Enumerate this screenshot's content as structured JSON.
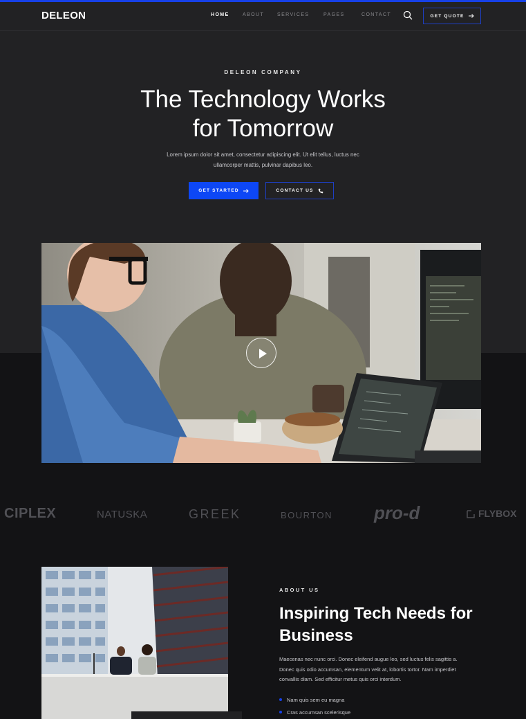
{
  "header": {
    "logo": "DELEON",
    "nav": [
      "HOME",
      "ABOUT",
      "SERVICES",
      "PAGES",
      "CONTACT"
    ],
    "active_nav": "HOME",
    "quote_button": "GET QUOTE"
  },
  "hero": {
    "eyebrow": "DELEON COMPANY",
    "title_lines": [
      "The Technology Works",
      "for Tomorrow"
    ],
    "description_lines": [
      "Lorem ipsum dolor sit amet, consectetur adipiscing elit. Ut elit tellus, luctus nec",
      "ullamcorper mattis, pulvinar dapibus leo."
    ],
    "primary_button": "GET STARTED",
    "secondary_button": "CONTACT US"
  },
  "video": {
    "play_icon": "play-icon"
  },
  "brands": [
    "CIPLEX",
    "NATUSKA",
    "GREEK",
    "BOURTON",
    "pro-d",
    "FLYBOX"
  ],
  "about": {
    "label": "ABOUT US",
    "title_lines": [
      "Inspiring Tech Needs for",
      "Business"
    ],
    "text_lines": [
      "Maecenas nec nunc orci. Donec eleifend augue leo, sed luctus felis sagittis a.",
      "Donec quis odio accumsan, elementum velit at, lobortis tortor. Nam imperdiet",
      "convallis diam. Sed efficitur metus quis orci interdum."
    ],
    "bullets": [
      "Nam quis sem eu magna",
      "Cras accumsan scelerisque"
    ]
  },
  "colors": {
    "accent": "#0d47f5",
    "hero_bg": "#222224",
    "page_bg": "#131315"
  }
}
